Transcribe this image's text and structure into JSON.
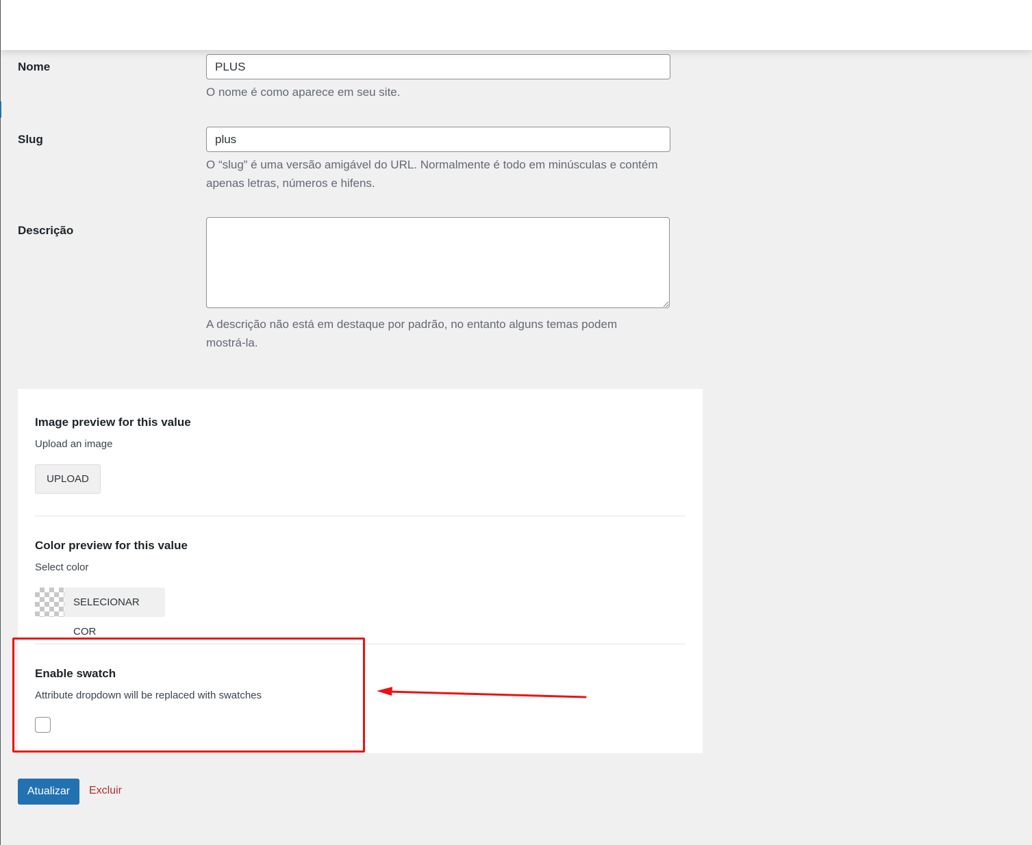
{
  "form": {
    "name": {
      "label": "Nome",
      "value": "PLUS",
      "help": "O nome é como aparece em seu site."
    },
    "slug": {
      "label": "Slug",
      "value": "plus",
      "help": "O “slug” é uma versão amigável do URL. Normalmente é todo em minúsculas e contém apenas letras, números e hifens."
    },
    "description": {
      "label": "Descrição",
      "value": "",
      "help": "A descrição não está em destaque por padrão, no entanto alguns temas podem mostrá-la."
    }
  },
  "swatch_panel": {
    "image": {
      "title": "Image preview for this value",
      "subtitle": "Upload an image",
      "button_label": "UPLOAD"
    },
    "color": {
      "title": "Color preview for this value",
      "subtitle": "Select color",
      "button_label": "SELECIONAR COR"
    },
    "enable": {
      "title": "Enable swatch",
      "subtitle": "Attribute dropdown will be replaced with swatches",
      "checked": false
    }
  },
  "actions": {
    "update_label": "Atualizar",
    "delete_label": "Excluir"
  },
  "annotation": {
    "color": "#ee1111"
  },
  "colors": {
    "primary": "#2271b1",
    "danger": "#b32d2e",
    "background": "#f0f0f1"
  }
}
